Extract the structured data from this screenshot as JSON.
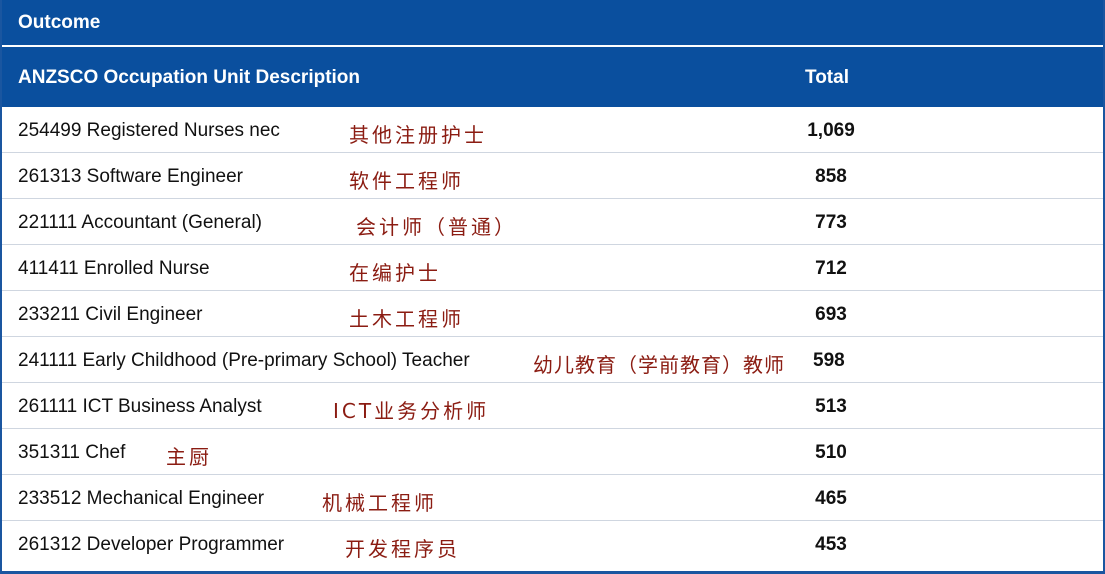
{
  "caption": "Outcome",
  "columns": {
    "description": "ANZSCO Occupation Unit Description",
    "total": "Total"
  },
  "rows": [
    {
      "description": "254499 Registered Nurses nec",
      "chinese": "其他注册护士",
      "total": "1,069"
    },
    {
      "description": "261313 Software Engineer",
      "chinese": "软件工程师",
      "total": "858"
    },
    {
      "description": "221111 Accountant (General)",
      "chinese": "会计师（普通）",
      "total": "773"
    },
    {
      "description": "411411 Enrolled Nurse",
      "chinese": "在编护士",
      "total": "712"
    },
    {
      "description": "233211 Civil Engineer",
      "chinese": "土木工程师",
      "total": "693"
    },
    {
      "description": "241111 Early Childhood (Pre-primary School) Teacher",
      "chinese": "幼儿教育（学前教育）教师",
      "total": "598"
    },
    {
      "description": "261111 ICT Business Analyst",
      "chinese": "ICT业务分析师",
      "total": "513"
    },
    {
      "description": "351311 Chef",
      "chinese": "主厨",
      "total": "510"
    },
    {
      "description": "233512 Mechanical Engineer",
      "chinese": "机械工程师",
      "total": "465"
    },
    {
      "description": "261312 Developer Programmer",
      "chinese": "开发程序员",
      "total": "453"
    }
  ],
  "colors": {
    "header_bg": "#0a4f9e",
    "chinese_text": "#8b1c12",
    "row_divider": "#cfd6e0"
  }
}
